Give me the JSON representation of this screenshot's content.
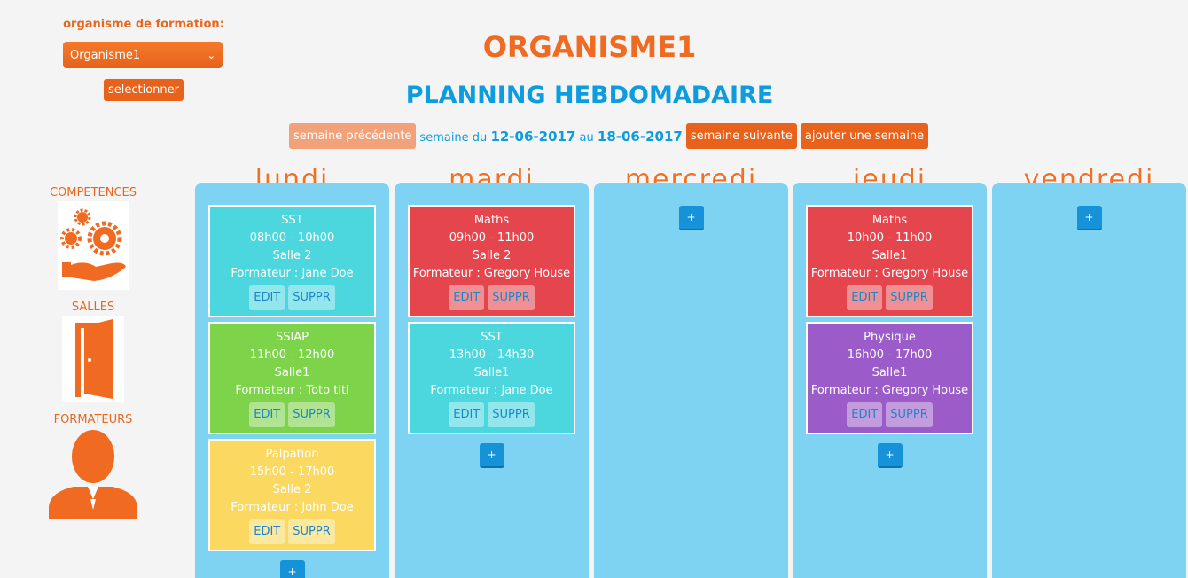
{
  "org": {
    "label": "organisme de formation:",
    "selected": "Organisme1",
    "select_button": "selectionner"
  },
  "title": "ORGANISME1",
  "subtitle": "PLANNING HEBDOMADAIRE",
  "week": {
    "prev": "semaine précédente",
    "text1": "semaine du",
    "start": "12-06-2017",
    "text2": "au",
    "end": "18-06-2017",
    "next": "semaine suivante",
    "add": "ajouter une semaine"
  },
  "sidebar": {
    "items": [
      {
        "label": "COMPETENCES",
        "icon": "gears-hand-icon"
      },
      {
        "label": "SALLES",
        "icon": "door-icon"
      },
      {
        "label": "FORMATEURS",
        "icon": "person-icon"
      }
    ]
  },
  "days": [
    {
      "name": "lundi",
      "sessions": [
        {
          "title": "SST",
          "time": "08h00 - 10h00",
          "room": "Salle 2",
          "trainer": "Formateur : Jane Doe",
          "color": "#4cd7df"
        },
        {
          "title": "SSIAP",
          "time": "11h00 - 12h00",
          "room": "Salle1",
          "trainer": "Formateur : Toto titi",
          "color": "#7dd34a"
        },
        {
          "title": "Palpation",
          "time": "15h00 - 17h00",
          "room": "Salle 2",
          "trainer": "Formateur : John Doe",
          "color": "#fbd960"
        }
      ]
    },
    {
      "name": "mardi",
      "sessions": [
        {
          "title": "Maths",
          "time": "09h00 - 11h00",
          "room": "Salle 2",
          "trainer": "Formateur : Gregory House",
          "color": "#e5464d"
        },
        {
          "title": "SST",
          "time": "13h00 - 14h30",
          "room": "Salle1",
          "trainer": "Formateur : Jane Doe",
          "color": "#4cd7df"
        }
      ]
    },
    {
      "name": "mercredi",
      "sessions": []
    },
    {
      "name": "jeudi",
      "sessions": [
        {
          "title": "Maths",
          "time": "10h00 - 11h00",
          "room": "Salle1",
          "trainer": "Formateur : Gregory House",
          "color": "#e5464d"
        },
        {
          "title": "Physique",
          "time": "16h00 - 17h00",
          "room": "Salle1",
          "trainer": "Formateur : Gregory House",
          "color": "#9b5bc8"
        }
      ]
    },
    {
      "name": "vendredi",
      "sessions": []
    }
  ],
  "labels": {
    "edit": "EDIT",
    "delete": "SUPPR",
    "add": "+"
  }
}
